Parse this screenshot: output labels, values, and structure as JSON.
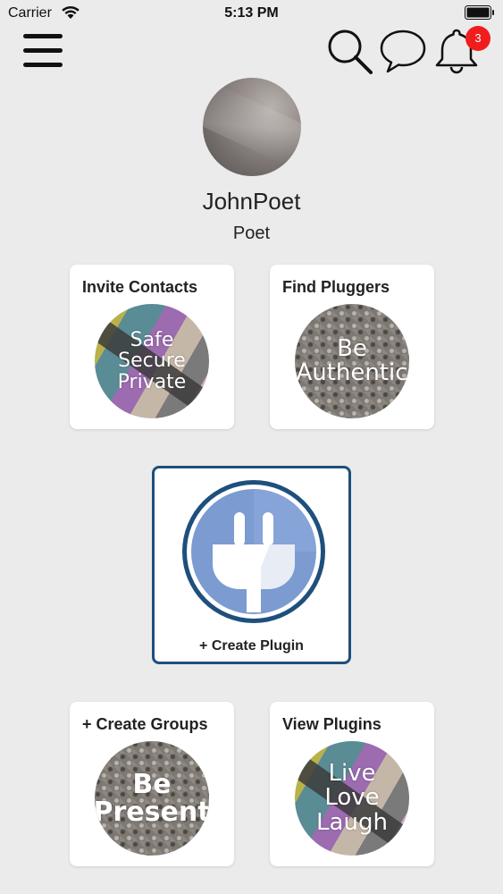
{
  "status_bar": {
    "carrier": "Carrier",
    "time": "5:13 PM"
  },
  "nav": {
    "notification_count": "3"
  },
  "profile": {
    "username": "JohnPoet",
    "role": "Poet"
  },
  "cards": {
    "invite_contacts": {
      "title": "Invite Contacts",
      "lines": [
        "Safe",
        "Secure",
        "Private"
      ]
    },
    "find_pluggers": {
      "title": "Find Pluggers",
      "lines": [
        "Be",
        "Authentic"
      ]
    },
    "create_plugin": {
      "label": "+ Create Plugin"
    },
    "create_groups": {
      "title": "+ Create Groups",
      "lines": [
        "Be",
        "Present"
      ]
    },
    "view_plugins": {
      "title": "View Plugins",
      "lines": [
        "Live",
        "Love",
        "Laugh"
      ]
    }
  },
  "colors": {
    "badge": "#f01d1d",
    "plugin_border": "#1e4f7d",
    "plugin_blue": "#7b9bd1"
  }
}
